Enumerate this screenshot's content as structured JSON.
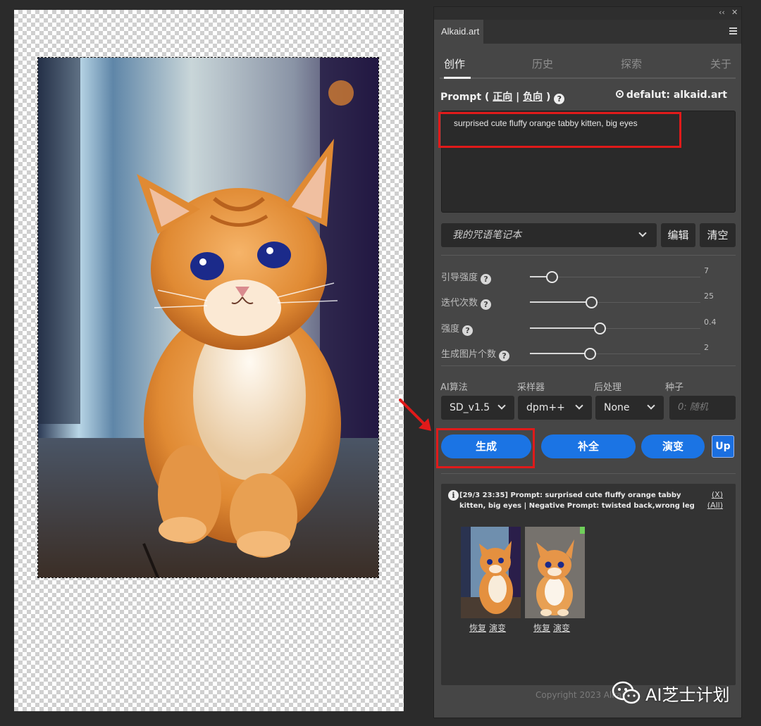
{
  "panel": {
    "tab_name": "Alkaid.art",
    "title_controls": {
      "collapse": "‹‹",
      "close": "✕"
    }
  },
  "nav": {
    "tabs": [
      "创作",
      "历史",
      "探索",
      "关于"
    ],
    "active": 0
  },
  "prompt": {
    "label_prefix": "Prompt ( ",
    "positive_label": "正向",
    "separator": " | ",
    "negative_label": "负向",
    "label_suffix": " )",
    "help": "?",
    "default_label": "defalut: alkaid.art",
    "text": "surprised cute fluffy orange tabby kitten, big eyes"
  },
  "notebook": {
    "selected": "我的咒语笔记本",
    "edit_label": "编辑",
    "clear_label": "清空"
  },
  "sliders": [
    {
      "label": "引导强度",
      "value": "7",
      "fraction": 0.13
    },
    {
      "label": "迭代次数",
      "value": "25",
      "fraction": 0.36
    },
    {
      "label": "强度",
      "value": "0.4",
      "fraction": 0.41
    },
    {
      "label": "生成图片个数",
      "value": "2",
      "fraction": 0.35
    }
  ],
  "params": {
    "algo_label": "AI算法",
    "algo_value": "SD_v1.5",
    "sampler_label": "采样器",
    "sampler_value": "dpm++",
    "post_label": "后处理",
    "post_value": "None",
    "seed_label": "种子",
    "seed_placeholder": "0: 随机"
  },
  "actions": {
    "generate": "生成",
    "complete": "补全",
    "evolve": "演变",
    "up": "Up"
  },
  "history": {
    "entry": "[29/3 23:35] Prompt: surprised cute fluffy orange tabby kitten, big eyes | Negative Prompt: twisted back,wrong leg",
    "close_link": "(X)",
    "all_link": "(All)",
    "thumb_actions": [
      "恢复",
      "演变"
    ]
  },
  "footer": {
    "copyright": "Copyright 2023 Alkaid"
  },
  "watermark": {
    "text": "AI芝士计划"
  },
  "colors": {
    "accent": "#1b74e4",
    "highlight": "#e01a1a",
    "panel_bg": "#464646"
  }
}
